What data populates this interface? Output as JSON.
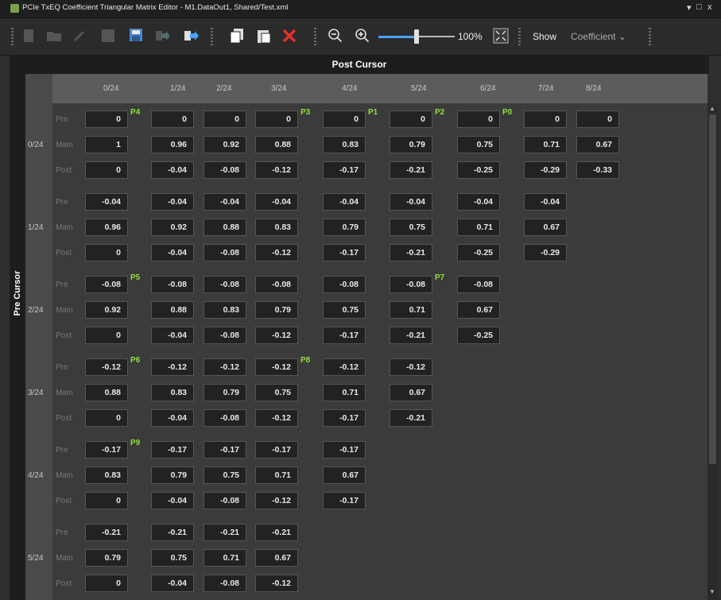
{
  "window": {
    "title": "PCIe TxEQ Coefficient Triangular Matrix Editor - M1.DataOut1, Shared/Test.xml",
    "controls": [
      "▾",
      "□",
      "x"
    ]
  },
  "toolbar": {
    "zoom_value": "100%",
    "show_label": "Show",
    "view_select": "Coefficient",
    "zoom_level": 0.5
  },
  "headers": {
    "post_cursor": "Post Cursor",
    "pre_cursor": "Pre Cursor"
  },
  "columns": [
    "0/24",
    "1/24",
    "2/24",
    "3/24",
    "4/24",
    "5/24",
    "6/24",
    "7/24",
    "8/24"
  ],
  "sub_labels": [
    "Pre",
    "Main",
    "Post"
  ],
  "groups": [
    {
      "label": "0/24",
      "pre": [
        "0",
        "0",
        "0",
        "0",
        "0",
        "0",
        "0",
        "0",
        "0"
      ],
      "main": [
        "1",
        "0.96",
        "0.92",
        "0.88",
        "0.83",
        "0.79",
        "0.75",
        "0.71",
        "0.67"
      ],
      "post": [
        "0",
        "-0.04",
        "-0.08",
        "-0.12",
        "-0.17",
        "-0.21",
        "-0.25",
        "-0.29",
        "-0.33"
      ]
    },
    {
      "label": "1/24",
      "pre": [
        "-0.04",
        "-0.04",
        "-0.04",
        "-0.04",
        "-0.04",
        "-0.04",
        "-0.04",
        "-0.04"
      ],
      "main": [
        "0.96",
        "0.92",
        "0.88",
        "0.83",
        "0.79",
        "0.75",
        "0.71",
        "0.67"
      ],
      "post": [
        "0",
        "-0.04",
        "-0.08",
        "-0.12",
        "-0.17",
        "-0.21",
        "-0.25",
        "-0.29"
      ]
    },
    {
      "label": "2/24",
      "pre": [
        "-0.08",
        "-0.08",
        "-0.08",
        "-0.08",
        "-0.08",
        "-0.08",
        "-0.08"
      ],
      "main": [
        "0.92",
        "0.88",
        "0.83",
        "0.79",
        "0.75",
        "0.71",
        "0.67"
      ],
      "post": [
        "0",
        "-0.04",
        "-0.08",
        "-0.12",
        "-0.17",
        "-0.21",
        "-0.25"
      ]
    },
    {
      "label": "3/24",
      "pre": [
        "-0.12",
        "-0.12",
        "-0.12",
        "-0.12",
        "-0.12",
        "-0.12"
      ],
      "main": [
        "0.88",
        "0.83",
        "0.79",
        "0.75",
        "0.71",
        "0.67"
      ],
      "post": [
        "0",
        "-0.04",
        "-0.08",
        "-0.12",
        "-0.17",
        "-0.21"
      ]
    },
    {
      "label": "4/24",
      "pre": [
        "-0.17",
        "-0.17",
        "-0.17",
        "-0.17",
        "-0.17"
      ],
      "main": [
        "0.83",
        "0.79",
        "0.75",
        "0.71",
        "0.67"
      ],
      "post": [
        "0",
        "-0.04",
        "-0.08",
        "-0.12",
        "-0.17"
      ]
    },
    {
      "label": "5/24",
      "pre": [
        "-0.21",
        "-0.21",
        "-0.21",
        "-0.21"
      ],
      "main": [
        "0.79",
        "0.75",
        "0.71",
        "0.67"
      ],
      "post": [
        "0",
        "-0.04",
        "-0.08",
        "-0.12"
      ]
    }
  ],
  "presets": [
    {
      "name": "P4",
      "group": 0,
      "col": 0
    },
    {
      "name": "P3",
      "group": 0,
      "col": 3
    },
    {
      "name": "P1",
      "group": 0,
      "col": 4
    },
    {
      "name": "P2",
      "group": 0,
      "col": 5
    },
    {
      "name": "P0",
      "group": 0,
      "col": 6
    },
    {
      "name": "P5",
      "group": 2,
      "col": 0
    },
    {
      "name": "P7",
      "group": 2,
      "col": 5
    },
    {
      "name": "P6",
      "group": 3,
      "col": 0
    },
    {
      "name": "P8",
      "group": 3,
      "col": 3
    },
    {
      "name": "P9",
      "group": 4,
      "col": 0
    }
  ],
  "colors": {
    "preset": "#8ee03a",
    "delete": "#e0302a",
    "zoom_accent": "#4aa3ff"
  }
}
